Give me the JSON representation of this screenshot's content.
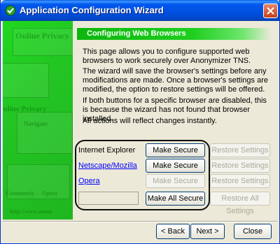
{
  "window": {
    "title": "Application Configuration Wizard"
  },
  "side_panel": {
    "decor": [
      "Online Privacy",
      "Online Privacy",
      "Navigate",
      "Community",
      "Opera",
      "http://www.anony"
    ]
  },
  "page": {
    "header": "Configuring Web Browsers",
    "paragraphs": [
      "This page allows you to configure supported web browsers to work securely over Anonymizer TNS.",
      "The wizard will save the browser's settings before any modifications are made. Once a browser's settings are modified, the option to restore settings will be offered.",
      "If both buttons for a specific browser are disabled, this is because the wizard has not found that browser installed.",
      "All actions will reflect changes instantly."
    ]
  },
  "browsers": [
    {
      "name": "Internet Explorer",
      "is_link": false,
      "secure_label": "Make Secure",
      "secure_enabled": true,
      "restore_label": "Restore Settings",
      "restore_enabled": false
    },
    {
      "name": "Netscape/Mozilla",
      "is_link": true,
      "secure_label": "Make Secure",
      "secure_enabled": true,
      "restore_label": "Restore Settings",
      "restore_enabled": false
    },
    {
      "name": "Opera",
      "is_link": true,
      "secure_label": "Make Secure",
      "secure_enabled": false,
      "restore_label": "Restore Settings",
      "restore_enabled": false
    }
  ],
  "all": {
    "secure_label": "Make All Secure",
    "restore_label": "Restore All Settings"
  },
  "footer": {
    "back_label": "< Back",
    "next_label": "Next >",
    "close_label": "Close"
  },
  "colors": {
    "accent_green": "#1fcf1f",
    "title_blue": "#0058ee",
    "link_blue": "#0000ff"
  }
}
